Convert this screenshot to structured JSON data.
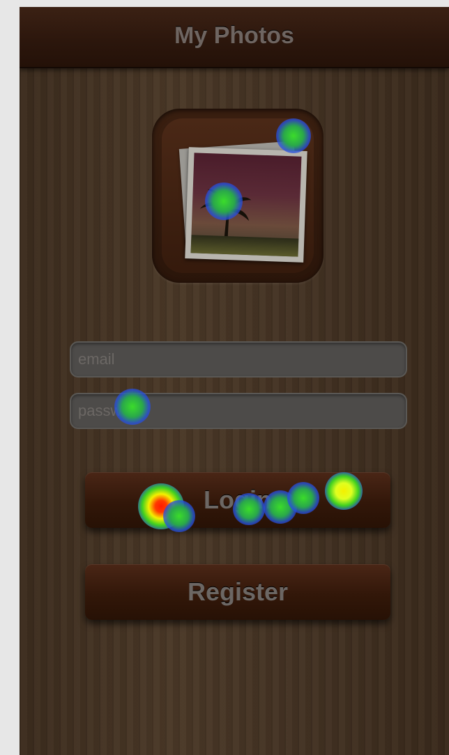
{
  "navbar": {
    "title": "My Photos"
  },
  "login_form": {
    "email_placeholder": "email",
    "password_placeholder": "password",
    "login_label": "Login",
    "register_label": "Register"
  },
  "icons": {
    "app_icon": "photo-stack-icon"
  },
  "colors": {
    "page_background": "#e7e7e7",
    "wood_background": "#433223",
    "navbar": "#2b160c",
    "button": "#321709",
    "field_background": "#4d4b49",
    "muted_text": "#6e6561"
  }
}
